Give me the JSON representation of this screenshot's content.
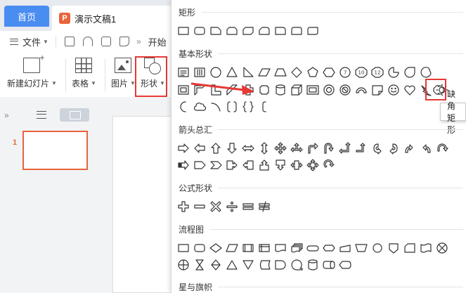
{
  "tabs": {
    "home": "首页",
    "document": "演示文稿1",
    "doc_icon": "P"
  },
  "quickbar": {
    "file_menu": "文件",
    "open_label": "开始"
  },
  "ribbon": {
    "new_slide": "新建幻灯片",
    "table": "表格",
    "picture": "图片",
    "shapes": "形状"
  },
  "slides": {
    "first_number": "1"
  },
  "panel": {
    "sections": {
      "rect": "矩形",
      "basic": "基本形状",
      "arrows": "箭头总汇",
      "formula": "公式形状",
      "flowchart": "流程图",
      "stars": "星与旗帜"
    },
    "tooltip": "缺角矩形"
  },
  "colors": {
    "accent_blue": "#4a8df0",
    "highlight_red": "#e53935",
    "slide_orange": "#e8643b"
  },
  "icons": [
    "hamburger-icon",
    "save-icon",
    "undo-icon",
    "print-icon",
    "preview-icon",
    "new-slide-icon",
    "table-icon",
    "picture-icon",
    "shape-icon",
    "list-view-icon",
    "thumbnail-view-icon"
  ]
}
